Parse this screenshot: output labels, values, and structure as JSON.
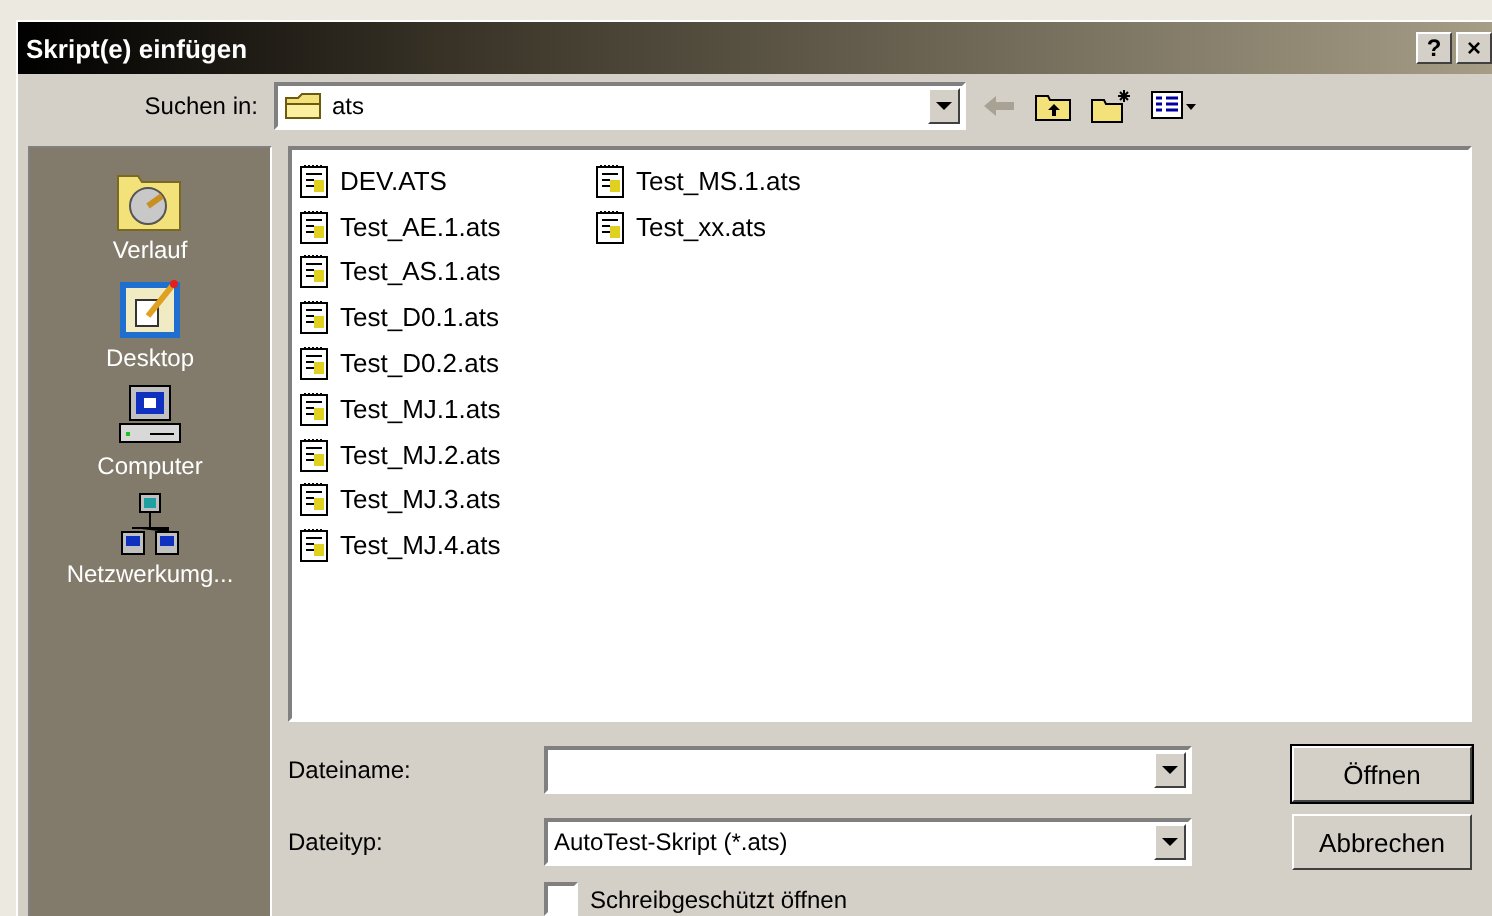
{
  "window": {
    "title": "Skript(e) einfügen",
    "help_button": "?",
    "close_button": "×"
  },
  "look_in": {
    "label": "Suchen in:",
    "value": "ats"
  },
  "places": [
    {
      "label": "Verlauf",
      "kind": "history"
    },
    {
      "label": "Desktop",
      "kind": "desktop"
    },
    {
      "label": "Computer",
      "kind": "computer"
    },
    {
      "label": "Netzwerkumg...",
      "kind": "network"
    }
  ],
  "files": [
    [
      "DEV.ATS",
      "Test_AE.1.ats",
      "Test_AS.1.ats",
      "Test_D0.1.ats",
      "Test_D0.2.ats",
      "Test_MJ.1.ats",
      "Test_MJ.2.ats",
      "Test_MJ.3.ats",
      "Test_MJ.4.ats"
    ],
    [
      "Test_MS.1.ats",
      "Test_xx.ats"
    ]
  ],
  "file_name": {
    "label": "Dateiname:"
  },
  "file_type": {
    "label": "Dateityp:",
    "value": "AutoTest-Skript (*.ats)"
  },
  "read_only": {
    "label": "Schreibgeschützt öffnen",
    "checked": false
  },
  "buttons": [
    "Öffnen",
    "Abbrechen"
  ]
}
